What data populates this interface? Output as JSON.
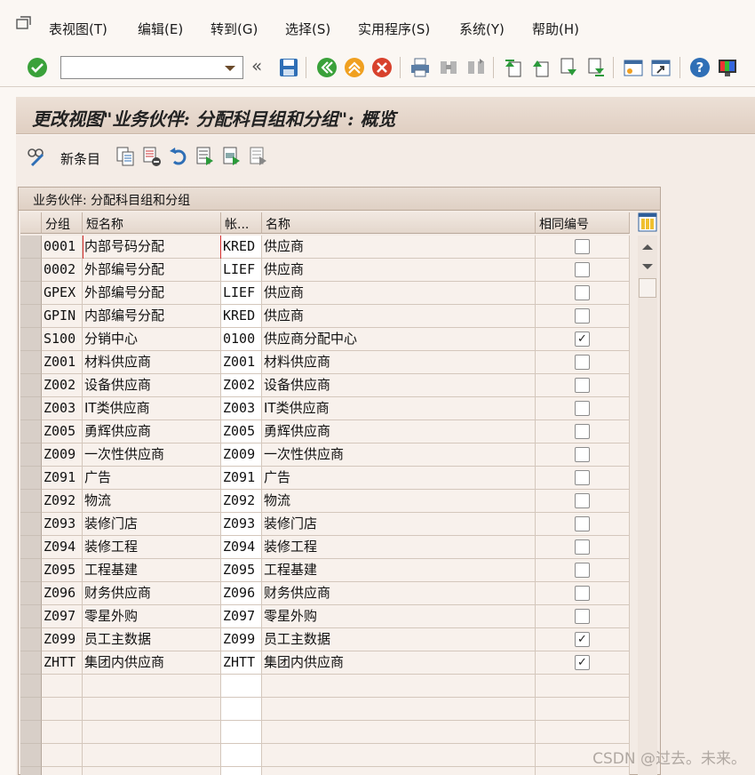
{
  "menu": {
    "items": [
      "表视图(T)",
      "编辑(E)",
      "转到(G)",
      "选择(S)",
      "实用程序(S)",
      "系统(Y)",
      "帮助(H)"
    ]
  },
  "toolbar": {
    "command_field_value": "",
    "icons": [
      "enter-icon",
      "command-field",
      "collapse-icon",
      "save-icon",
      "back-icon",
      "exit-icon",
      "cancel-icon",
      "print-icon",
      "find-icon",
      "find-next-icon",
      "first-page-icon",
      "previous-page-icon",
      "next-page-icon",
      "last-page-icon",
      "create-session-icon",
      "shortcut-icon",
      "help-icon",
      "customize-layout-icon"
    ]
  },
  "title": "更改视图\"业务伙伴: 分配科目组和分组\": 概览",
  "app_toolbar": {
    "new_entries_label": "新条目",
    "icons": [
      "display-change-icon",
      "copy-icon",
      "delete-icon",
      "undo-icon",
      "select-all-icon",
      "select-block-icon",
      "deselect-all-icon"
    ]
  },
  "table": {
    "title": "业务伙伴: 分配科目组和分组",
    "columns": [
      "分组",
      "短名称",
      "帐...",
      "名称",
      "相同编号"
    ],
    "rows": [
      {
        "group": "0001",
        "short": "内部号码分配",
        "acct": "KRED",
        "name": "供应商",
        "same": false
      },
      {
        "group": "0002",
        "short": "外部编号分配",
        "acct": "LIEF",
        "name": "供应商",
        "same": false
      },
      {
        "group": "GPEX",
        "short": "外部编号分配",
        "acct": "LIEF",
        "name": "供应商",
        "same": false
      },
      {
        "group": "GPIN",
        "short": "内部编号分配",
        "acct": "KRED",
        "name": "供应商",
        "same": false
      },
      {
        "group": "S100",
        "short": "分销中心",
        "acct": "0100",
        "name": "供应商分配中心",
        "same": true
      },
      {
        "group": "Z001",
        "short": "材料供应商",
        "acct": "Z001",
        "name": "材料供应商",
        "same": false
      },
      {
        "group": "Z002",
        "short": "设备供应商",
        "acct": "Z002",
        "name": "设备供应商",
        "same": false
      },
      {
        "group": "Z003",
        "short": "IT类供应商",
        "acct": "Z003",
        "name": "IT类供应商",
        "same": false
      },
      {
        "group": "Z005",
        "short": "勇辉供应商",
        "acct": "Z005",
        "name": "勇辉供应商",
        "same": false
      },
      {
        "group": "Z009",
        "short": "一次性供应商",
        "acct": "Z009",
        "name": "一次性供应商",
        "same": false
      },
      {
        "group": "Z091",
        "short": "广告",
        "acct": "Z091",
        "name": "广告",
        "same": false
      },
      {
        "group": "Z092",
        "short": "物流",
        "acct": "Z092",
        "name": "物流",
        "same": false
      },
      {
        "group": "Z093",
        "short": "装修门店",
        "acct": "Z093",
        "name": "装修门店",
        "same": false
      },
      {
        "group": "Z094",
        "short": "装修工程",
        "acct": "Z094",
        "name": "装修工程",
        "same": false
      },
      {
        "group": "Z095",
        "short": "工程基建",
        "acct": "Z095",
        "name": "工程基建",
        "same": false
      },
      {
        "group": "Z096",
        "short": "财务供应商",
        "acct": "Z096",
        "name": "财务供应商",
        "same": false
      },
      {
        "group": "Z097",
        "short": "零星外购",
        "acct": "Z097",
        "name": "零星外购",
        "same": false
      },
      {
        "group": "Z099",
        "short": "员工主数据",
        "acct": "Z099",
        "name": "员工主数据",
        "same": true
      },
      {
        "group": "ZHTT",
        "short": "集团内供应商",
        "acct": "ZHTT",
        "name": "集团内供应商",
        "same": true
      }
    ],
    "empty_rows": 5
  },
  "watermark": "CSDN @过去。未来。",
  "colors": {
    "background": "#fbf7f3",
    "title_bar": "#e0cfc2",
    "table_header": "#e4d7cc",
    "enter_green": "#3aa13a",
    "save_blue": "#2f6fb6",
    "exit_orange": "#f0a020",
    "cancel_red": "#d8412c"
  }
}
